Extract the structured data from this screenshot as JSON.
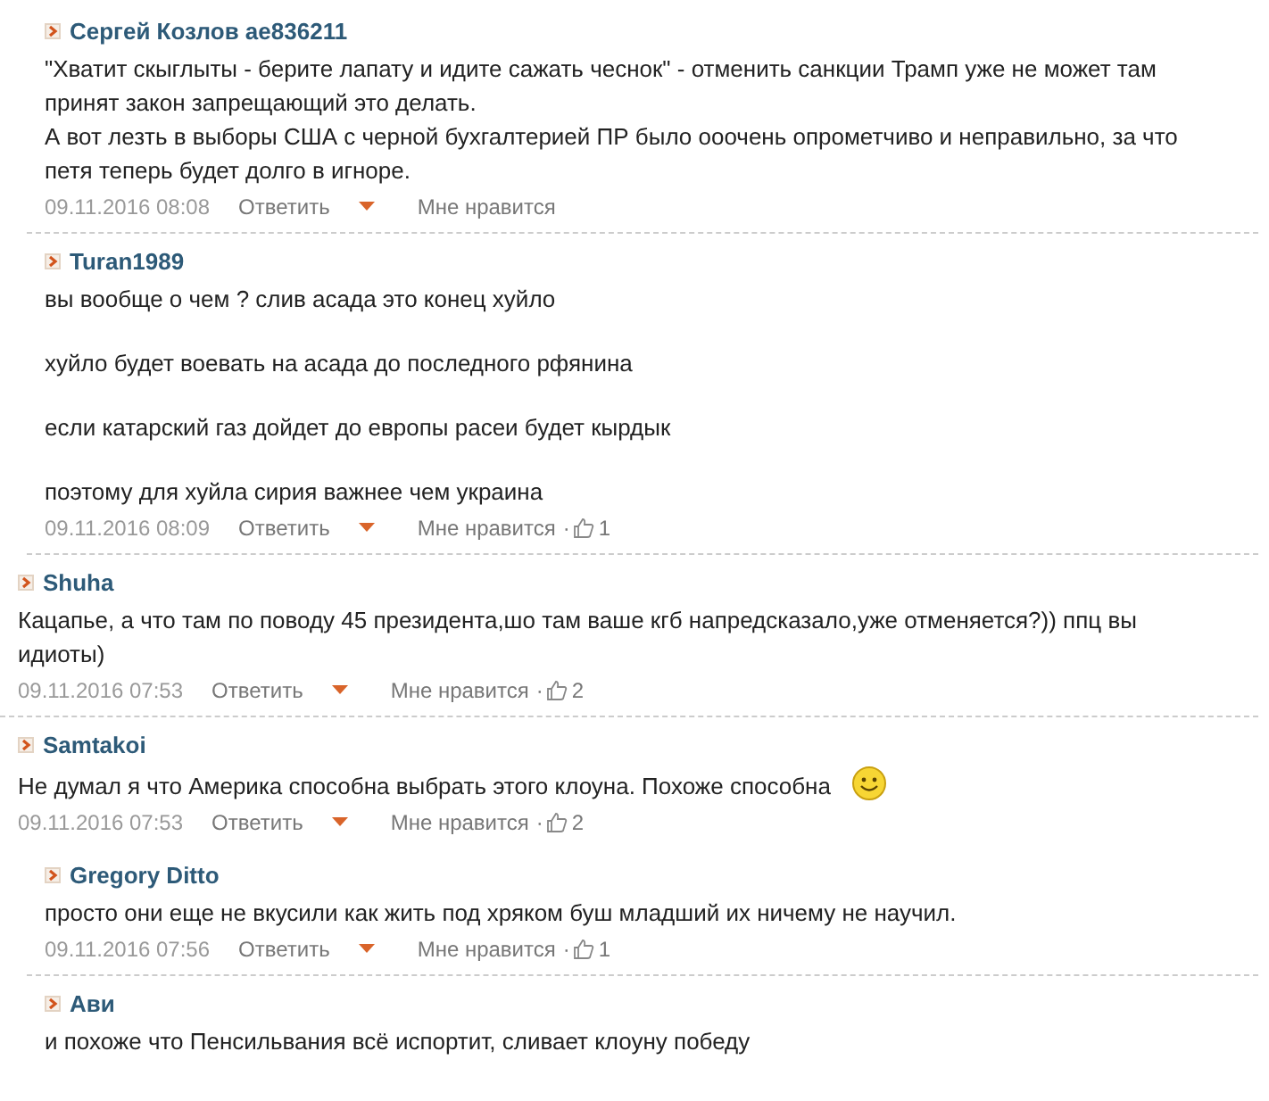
{
  "leading_replies": [
    {
      "author": "Сергей Козлов ae836211",
      "paragraphs": [
        "\"Хватит скыглыты - берите лапату и идите сажать чеснок\" - отменить санкции Трамп уже не может там принят закон запрещающий это делать.\nА вот лезть в выборы США с черной бухгалтерией ПР было ооочень опрометчиво и неправильно, за что петя теперь будет долго в игноре."
      ],
      "meta": {
        "date": "09.11.2016 08:08",
        "reply": "Ответить",
        "like": "Мне нравится"
      }
    },
    {
      "author": "Turan1989",
      "paragraphs": [
        "вы вообще о чем ? слив асада это конец хуйло",
        "хуйло будет воевать на асада до последного рфянина",
        "если катарский газ дойдет до европы расеи будет кырдык",
        "поэтому для хуйла сирия важнее чем украина"
      ],
      "meta": {
        "date": "09.11.2016 08:09",
        "reply": "Ответить",
        "like": "Мне нравится",
        "separator": "·",
        "likes": "1"
      }
    }
  ],
  "comments": [
    {
      "author": "Shuha",
      "paragraphs": [
        "Кацапье, а что там по поводу 45 президента,шо там ваше кгб напредсказало,уже отменяется?)) ппц вы идиоты)"
      ],
      "meta": {
        "date": "09.11.2016 07:53",
        "reply": "Ответить",
        "like": "Мне нравится",
        "separator": "·",
        "likes": "2"
      }
    },
    {
      "author": "Samtakoi",
      "smiley": true,
      "paragraphs": [
        "Не думал я что Америка способна выбрать этого клоуна. Похоже способна"
      ],
      "meta": {
        "date": "09.11.2016 07:53",
        "reply": "Ответить",
        "like": "Мне нравится",
        "separator": "·",
        "likes": "2"
      },
      "children": [
        {
          "author": "Gregory Ditto",
          "paragraphs": [
            "просто они еще не вкусили как жить под хряком буш младший их ничему не научил."
          ],
          "meta": {
            "date": "09.11.2016 07:56",
            "reply": "Ответить",
            "like": "Мне нравится",
            "separator": "·",
            "likes": "1"
          }
        },
        {
          "author": "Ави",
          "paragraphs": [
            "и похоже что Пенсильвания всё испортит, сливает клоуну победу"
          ]
        }
      ]
    }
  ]
}
